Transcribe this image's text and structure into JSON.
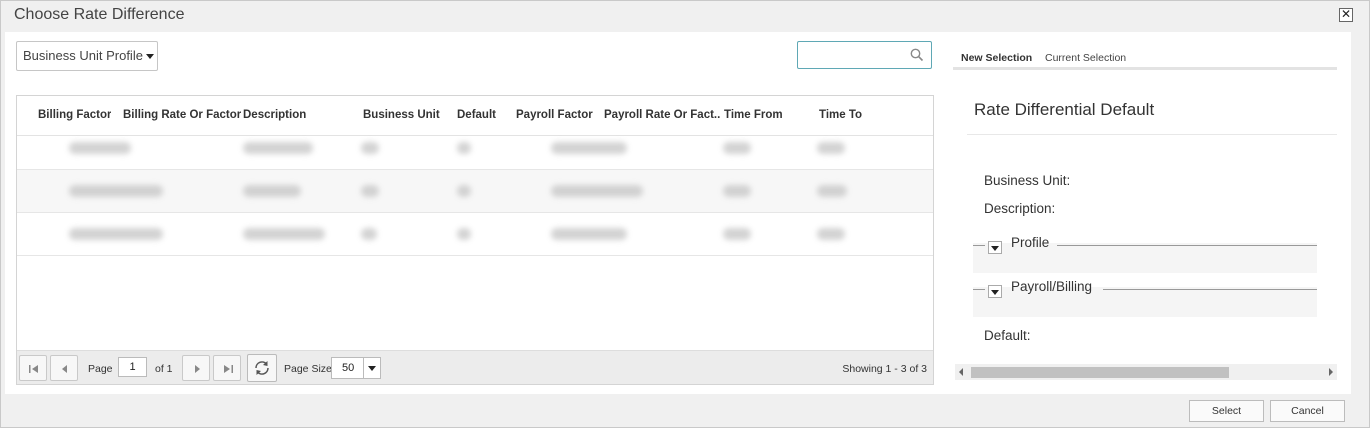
{
  "dialog": {
    "title": "Choose Rate Difference",
    "close_label": "✕"
  },
  "toolbar": {
    "profile_dropdown": "Business Unit Profile",
    "search_placeholder": ""
  },
  "grid": {
    "columns": [
      "Billing Factor",
      "Billing Rate Or Factor",
      "Description",
      "Business Unit",
      "Default",
      "Payroll Factor",
      "Payroll Rate Or Fact...",
      "Time From",
      "Time To"
    ]
  },
  "pager": {
    "page_label": "Page",
    "page_value": "1",
    "of_label": "of 1",
    "page_size_label": "Page Size",
    "page_size_value": "50",
    "showing": "Showing 1 - 3 of 3"
  },
  "right": {
    "tabs": [
      "New Selection",
      "Current Selection"
    ],
    "title": "Rate Differential Default",
    "business_unit_label": "Business Unit:",
    "description_label": "Description:",
    "profile_section": "Profile",
    "payroll_section": "Payroll/Billing",
    "default_label": "Default:"
  },
  "footer": {
    "select_label": "Select",
    "cancel_label": "Cancel"
  }
}
